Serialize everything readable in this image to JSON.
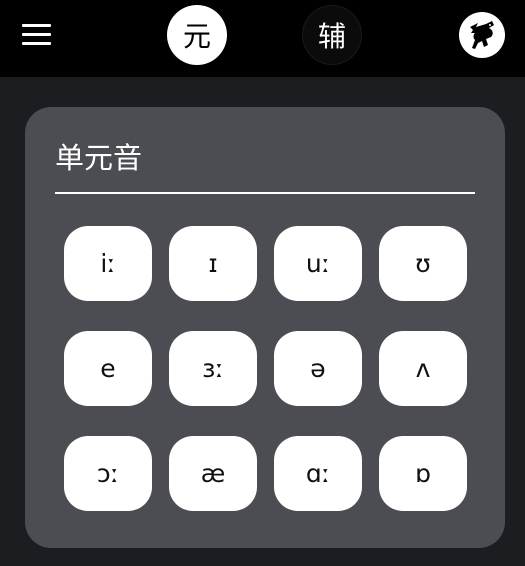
{
  "header": {
    "tabs": [
      {
        "label": "元",
        "active": true
      },
      {
        "label": "辅",
        "active": false
      }
    ],
    "menu_icon": "hamburger-menu-icon",
    "logo_icon": "running-rabbit-logo-icon"
  },
  "card": {
    "title": "单元音",
    "phonemes": [
      "iː",
      "ɪ",
      "uː",
      "ʊ",
      "e",
      "ɜː",
      "ə",
      "ʌ",
      "ɔː",
      "æ",
      "ɑː",
      "ɒ"
    ]
  },
  "colors": {
    "topbar": "#000000",
    "background": "#1c1d21",
    "card": "#4b4d53",
    "button": "#ffffff"
  }
}
